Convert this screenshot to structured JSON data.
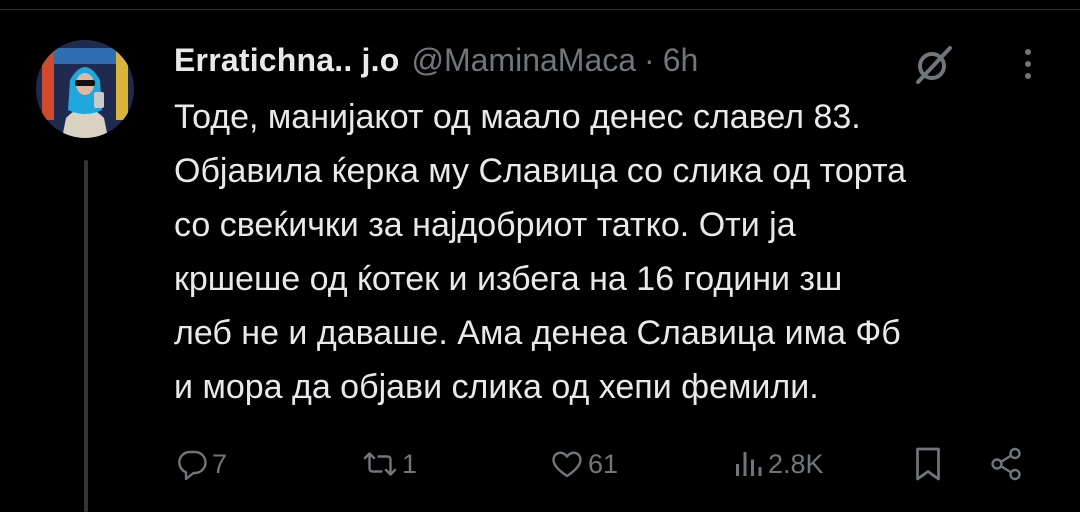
{
  "author": {
    "display_name": "Erratichna.. j.o",
    "handle": "@MaminaMaca",
    "separator": "·",
    "time": "6h"
  },
  "tweet": {
    "lines": [
      "Тоде, манијакот од маало денес славел 83.",
      "Објавила ќерка му Славица со слика од торта",
      "со свеќички за најдобриот татко. Оти ја",
      "кршеше од ќотек и избега на 16 години зш",
      "леб не и даваше. Ама денеа Славица има Фб",
      "и мора да објави слика од хепи фемили."
    ]
  },
  "actions": {
    "replies": "7",
    "retweets": "1",
    "likes": "61",
    "views": "2.8K"
  },
  "icons": [
    "grok-icon",
    "more-icon",
    "reply-icon",
    "retweet-icon",
    "like-icon",
    "views-icon",
    "bookmark-icon",
    "share-icon"
  ],
  "colors": {
    "background": "#000000",
    "text": "#e7e9ea",
    "secondary": "#71767b",
    "divider": "#2f3336"
  }
}
